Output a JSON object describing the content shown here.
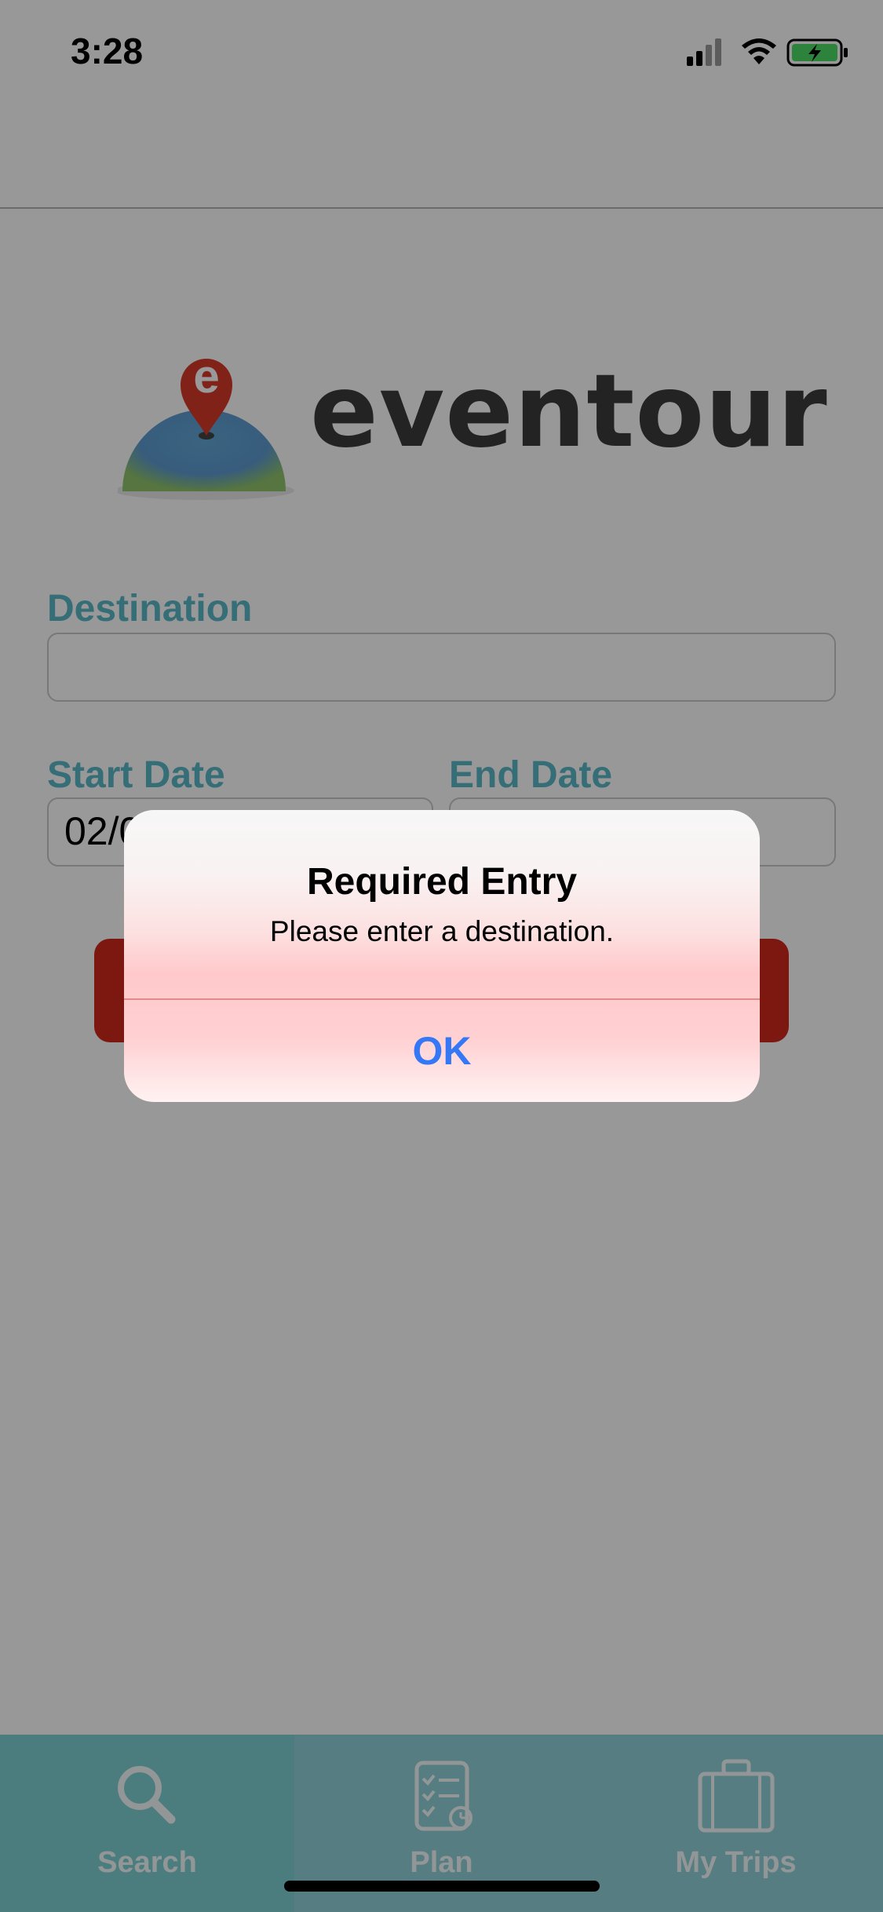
{
  "status_bar": {
    "time": "3:28"
  },
  "app": {
    "logo_text": "eventour",
    "logo_letter": "e"
  },
  "form": {
    "destination_label": "Destination",
    "destination_value": "",
    "start_date_label": "Start Date",
    "start_date_value": "02/0",
    "end_date_label": "End Date",
    "end_date_value": ""
  },
  "alert": {
    "title": "Required Entry",
    "message": "Please enter a destination.",
    "ok_label": "OK"
  },
  "tab_bar": {
    "tabs": [
      {
        "label": "Search",
        "icon": "search-icon",
        "active": true
      },
      {
        "label": "Plan",
        "icon": "checklist-icon",
        "active": false
      },
      {
        "label": "My Trips",
        "icon": "suitcase-icon",
        "active": false
      }
    ]
  },
  "colors": {
    "accent": "#5bb7c7",
    "button": "#d0281b",
    "tab_bar": "#8fd1d8",
    "alert_button": "#3478f6"
  }
}
